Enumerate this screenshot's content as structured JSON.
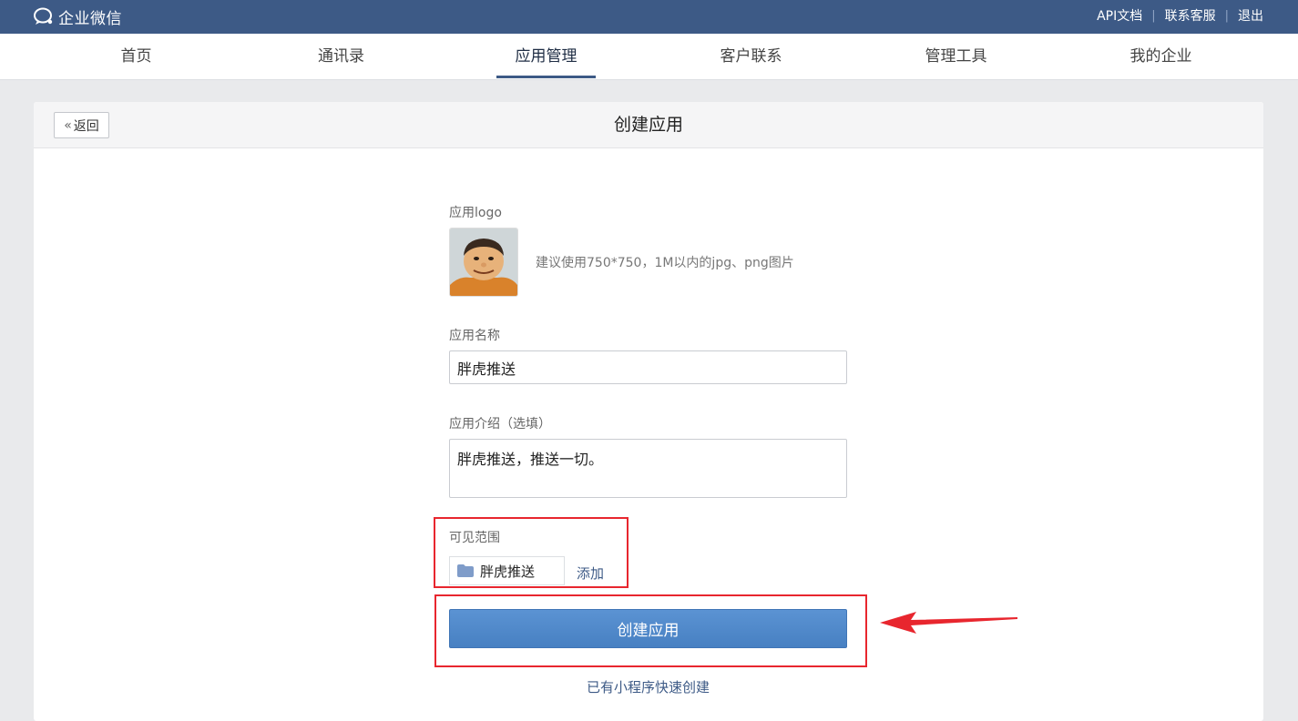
{
  "topbar": {
    "brand": "企业微信",
    "links": [
      "API文档",
      "联系客服",
      "退出"
    ],
    "separator": "|"
  },
  "nav": {
    "items": [
      "首页",
      "通讯录",
      "应用管理",
      "客户联系",
      "管理工具",
      "我的企业"
    ],
    "active_index": 2
  },
  "page": {
    "back_label": "返回",
    "title": "创建应用"
  },
  "form": {
    "logo_label": "应用logo",
    "logo_hint": "建议使用750*750，1M以内的jpg、png图片",
    "name_label": "应用名称",
    "name_value": "胖虎推送",
    "intro_label": "应用介绍（选填）",
    "intro_value": "胖虎推送，推送一切。",
    "visibility_label": "可见范围",
    "visibility_tag": "胖虎推送",
    "add_label": "添加",
    "submit_label": "创建应用",
    "miniprogram_link": "已有小程序快速创建"
  },
  "colors": {
    "topbar": "#3d5a86",
    "primary_button": "#4f88c9",
    "highlight": "#e8262e"
  }
}
